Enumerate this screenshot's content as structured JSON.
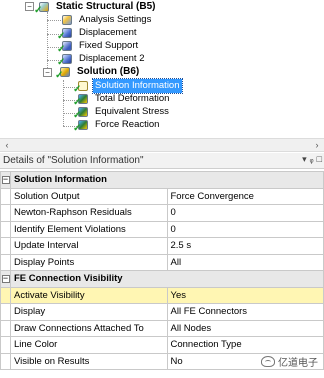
{
  "tree": {
    "nodes": [
      {
        "key": "root",
        "label": "Static Structural (B5)",
        "bold": true
      },
      {
        "key": "analysis",
        "label": "Analysis Settings"
      },
      {
        "key": "disp1",
        "label": "Displacement"
      },
      {
        "key": "fixed",
        "label": "Fixed Support"
      },
      {
        "key": "disp2",
        "label": "Displacement 2"
      },
      {
        "key": "solution",
        "label": "Solution (B6)",
        "bold": true
      },
      {
        "key": "solinfo",
        "label": "Solution Information",
        "selected": true
      },
      {
        "key": "totdef",
        "label": "Total Deformation"
      },
      {
        "key": "eqstress",
        "label": "Equivalent Stress"
      },
      {
        "key": "force",
        "label": "Force Reaction"
      }
    ],
    "expander_collapse_glyph": "−"
  },
  "scrollbar": {
    "left_arrow": "‹",
    "right_arrow": "›"
  },
  "details": {
    "title": "Details of \"Solution Information\"",
    "tools": {
      "dropdown": "▾",
      "pin": "ᵩ",
      "close": "□"
    }
  },
  "groups": [
    {
      "label": "Solution Information",
      "rows": [
        {
          "name": "Solution Output",
          "value": "Force Convergence"
        },
        {
          "name": "Newton-Raphson Residuals",
          "value": "0"
        },
        {
          "name": "Identify Element Violations",
          "value": "0"
        },
        {
          "name": "Update Interval",
          "value": "2.5 s"
        },
        {
          "name": "Display Points",
          "value": "All"
        }
      ]
    },
    {
      "label": "FE Connection Visibility",
      "rows": [
        {
          "name": "Activate Visibility",
          "value": "Yes",
          "highlight": true
        },
        {
          "name": "Display",
          "value": "All FE Connectors"
        },
        {
          "name": "Draw Connections Attached To",
          "value": "All Nodes"
        },
        {
          "name": "Line Color",
          "value": "Connection Type"
        },
        {
          "name": "Visible on Results",
          "value": "No"
        }
      ]
    }
  ],
  "group_toggle": "−",
  "watermark": {
    "text": "亿道电子"
  },
  "colors": {
    "selection": "#3399ff",
    "check": "#1e9e2a",
    "highlight_row": "#fff6b3"
  }
}
